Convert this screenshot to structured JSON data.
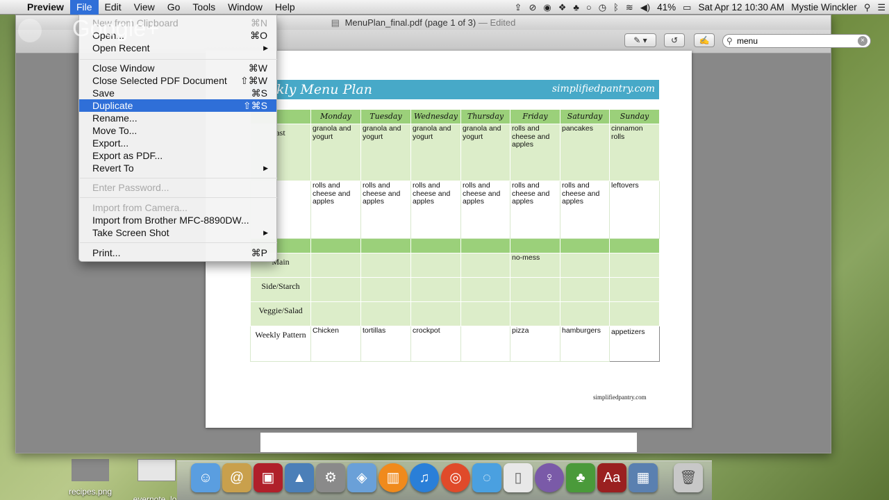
{
  "menubar": {
    "app_name": "Preview",
    "menus": [
      "File",
      "Edit",
      "View",
      "Go",
      "Tools",
      "Window",
      "Help"
    ],
    "status": {
      "battery": "41%",
      "datetime": "Sat Apr 12  10:30 AM",
      "user": "Mystie Winckler"
    }
  },
  "window": {
    "title": "MenuPlan_final.pdf (page 1 of 3)",
    "edited": "— Edited",
    "search_value": "menu"
  },
  "file_menu": {
    "items": [
      {
        "label": "New from Clipboard",
        "shortcut": "⌘N",
        "disabled": true
      },
      {
        "label": "Open...",
        "shortcut": "⌘O"
      },
      {
        "label": "Open Recent",
        "submenu": true
      },
      {
        "label": "Close Window",
        "shortcut": "⌘W"
      },
      {
        "label": "Close Selected PDF Document",
        "shortcut": "⇧⌘W"
      },
      {
        "label": "Save",
        "shortcut": "⌘S"
      },
      {
        "label": "Duplicate",
        "shortcut": "⇧⌘S",
        "highlighted": true
      },
      {
        "label": "Rename..."
      },
      {
        "label": "Move To..."
      },
      {
        "label": "Export..."
      },
      {
        "label": "Export as PDF..."
      },
      {
        "label": "Revert To",
        "submenu": true
      },
      {
        "label": "Enter Password...",
        "disabled": true
      },
      {
        "label": "Import from Camera...",
        "disabled": true
      },
      {
        "label": "Import from Brother MFC-8890DW..."
      },
      {
        "label": "Take Screen Shot",
        "submenu": true
      },
      {
        "label": "Print...",
        "shortcut": "⌘P"
      }
    ]
  },
  "document": {
    "banner_title": "kly Menu Plan",
    "banner_site": "simplifiedpantry.com",
    "days": [
      "Monday",
      "Tuesday",
      "Wednesday",
      "Thursday",
      "Friday",
      "Saturday",
      "Sunday"
    ],
    "rows": [
      {
        "label": "ast",
        "cells": [
          "granola and yogurt",
          "granola and yogurt",
          "granola and yogurt",
          "granola and yogurt",
          "rolls and cheese and apples",
          "pancakes",
          "cinnamon rolls"
        ]
      },
      {
        "label": "",
        "cells": [
          "rolls and cheese and apples",
          "rolls and cheese and apples",
          "rolls and cheese and apples",
          "rolls and cheese and apples",
          "rolls and cheese and apples",
          "rolls and cheese and apples",
          "leftovers"
        ]
      },
      {
        "label": "Main",
        "cells": [
          "",
          "",
          "",
          "",
          "no-mess",
          "",
          ""
        ]
      },
      {
        "label": "Side/Starch",
        "cells": [
          "",
          "",
          "",
          "",
          "",
          "",
          ""
        ]
      },
      {
        "label": "Veggie/Salad",
        "cells": [
          "",
          "",
          "",
          "",
          "",
          "",
          ""
        ]
      },
      {
        "label": "Weekly Pattern",
        "cells": [
          "Chicken",
          "tortillas",
          "crockpot",
          "",
          "pizza",
          "hamburgers",
          "appetizers"
        ]
      }
    ],
    "footer": "simplifiedpantry.com"
  },
  "overlay": {
    "brand": "Google+"
  },
  "desktop": {
    "icons": [
      "recipes.png",
      "evernote_lo"
    ]
  },
  "colors": {
    "banner": "#47a9c8",
    "header_green": "#9bd07a",
    "row_green": "#dcedc9",
    "highlight": "#2f6fd8"
  }
}
